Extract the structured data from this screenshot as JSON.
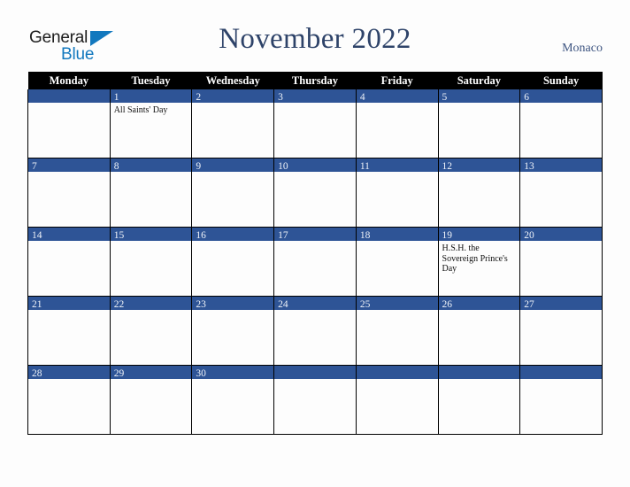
{
  "brand": {
    "name_top": "General",
    "name_bottom": "Blue",
    "triangle_color": "#1278be",
    "top_text_color": "#1d1d1d"
  },
  "header": {
    "title": "November 2022",
    "location": "Monaco",
    "title_color": "#2e4369",
    "location_color": "#3d5480"
  },
  "colors": {
    "page_background": "#fdfdfd",
    "header_row_background": "#000000",
    "header_row_text": "#ffffff",
    "date_bar_background": "#2e5496",
    "date_bar_text": "#eef2f8",
    "cell_border": "#000000",
    "cell_background": "#fdfdfd",
    "event_text": "#111111"
  },
  "weekday_headers": [
    "Monday",
    "Tuesday",
    "Wednesday",
    "Thursday",
    "Friday",
    "Saturday",
    "Sunday"
  ],
  "weeks": [
    [
      {
        "day": "",
        "events": []
      },
      {
        "day": "1",
        "events": [
          "All Saints' Day"
        ]
      },
      {
        "day": "2",
        "events": []
      },
      {
        "day": "3",
        "events": []
      },
      {
        "day": "4",
        "events": []
      },
      {
        "day": "5",
        "events": []
      },
      {
        "day": "6",
        "events": []
      }
    ],
    [
      {
        "day": "7",
        "events": []
      },
      {
        "day": "8",
        "events": []
      },
      {
        "day": "9",
        "events": []
      },
      {
        "day": "10",
        "events": []
      },
      {
        "day": "11",
        "events": []
      },
      {
        "day": "12",
        "events": []
      },
      {
        "day": "13",
        "events": []
      }
    ],
    [
      {
        "day": "14",
        "events": []
      },
      {
        "day": "15",
        "events": []
      },
      {
        "day": "16",
        "events": []
      },
      {
        "day": "17",
        "events": []
      },
      {
        "day": "18",
        "events": []
      },
      {
        "day": "19",
        "events": [
          "H.S.H. the Sovereign Prince's Day"
        ]
      },
      {
        "day": "20",
        "events": []
      }
    ],
    [
      {
        "day": "21",
        "events": []
      },
      {
        "day": "22",
        "events": []
      },
      {
        "day": "23",
        "events": []
      },
      {
        "day": "24",
        "events": []
      },
      {
        "day": "25",
        "events": []
      },
      {
        "day": "26",
        "events": []
      },
      {
        "day": "27",
        "events": []
      }
    ],
    [
      {
        "day": "28",
        "events": []
      },
      {
        "day": "29",
        "events": []
      },
      {
        "day": "30",
        "events": []
      },
      {
        "day": "",
        "events": []
      },
      {
        "day": "",
        "events": []
      },
      {
        "day": "",
        "events": []
      },
      {
        "day": "",
        "events": []
      }
    ]
  ]
}
